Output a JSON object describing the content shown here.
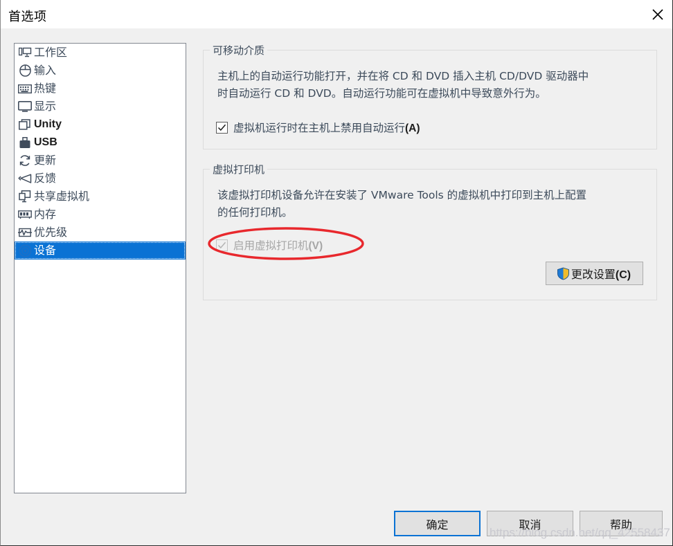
{
  "window": {
    "title": "首选项",
    "close_icon": "close-icon"
  },
  "colors": {
    "dialog_bg": "#f0f0f0",
    "selection_blue": "#0a72d4",
    "text": "#3c4a5a",
    "annotation_red": "#e8282d",
    "watermark": "#c9c9cf"
  },
  "sidebar": {
    "items": [
      {
        "label": "工作区",
        "icon": "workspace-icon",
        "selected": false,
        "latin": false
      },
      {
        "label": "输入",
        "icon": "mouse-input-icon",
        "selected": false,
        "latin": false
      },
      {
        "label": "热键",
        "icon": "keyboard-hotkey-icon",
        "selected": false,
        "latin": false
      },
      {
        "label": "显示",
        "icon": "monitor-display-icon",
        "selected": false,
        "latin": false
      },
      {
        "label": "Unity",
        "icon": "unity-windows-icon",
        "selected": false,
        "latin": true
      },
      {
        "label": "USB",
        "icon": "usb-drive-icon",
        "selected": false,
        "latin": true
      },
      {
        "label": "更新",
        "icon": "refresh-update-icon",
        "selected": false,
        "latin": false
      },
      {
        "label": "反馈",
        "icon": "megaphone-feedback-icon",
        "selected": false,
        "latin": false
      },
      {
        "label": "共享虚拟机",
        "icon": "shared-vm-icon",
        "selected": false,
        "latin": false
      },
      {
        "label": "内存",
        "icon": "memory-ram-icon",
        "selected": false,
        "latin": false
      },
      {
        "label": "优先级",
        "icon": "priority-pulse-icon",
        "selected": false,
        "latin": false
      },
      {
        "label": "设备",
        "icon": "device-disc-icon",
        "selected": true,
        "latin": false
      }
    ]
  },
  "removable_media": {
    "legend": "可移动介质",
    "description_line1": "主机上的自动运行功能打开，并在将 CD 和 DVD 插入主机 CD/DVD 驱动器中",
    "description_line2": "时自动运行 CD 和 DVD。自动运行功能可在虚拟机中导致意外行为。",
    "checkbox": {
      "label": "虚拟机运行时在主机上禁用自动运行(A)",
      "label_text": "虚拟机运行时在主机上禁用自动运行",
      "mnemonic": "(A)",
      "checked": true,
      "disabled": false
    }
  },
  "virtual_printer": {
    "legend": "虚拟打印机",
    "description_line1": "该虚拟打印机设备允许在安装了 VMware Tools 的虚拟机中打印到主机上配置",
    "description_line2": "的任何打印机。",
    "checkbox": {
      "label": "启用虚拟打印机(V)",
      "label_text": "启用虚拟打印机",
      "mnemonic": "(V)",
      "checked": true,
      "disabled": true
    },
    "change_settings_button": {
      "label": "更改设置(C)",
      "label_text": "更改设置",
      "mnemonic": "(C)",
      "icon": "uac-shield-icon"
    }
  },
  "footer": {
    "ok_button": "确定",
    "cancel_button": "取消",
    "help_button": "帮助"
  },
  "annotation": {
    "shape": "red-ellipse-highlight",
    "target": "启用虚拟打印机(V)"
  },
  "watermark": {
    "text": "https://blog.csdn.net/qq_42558437"
  }
}
